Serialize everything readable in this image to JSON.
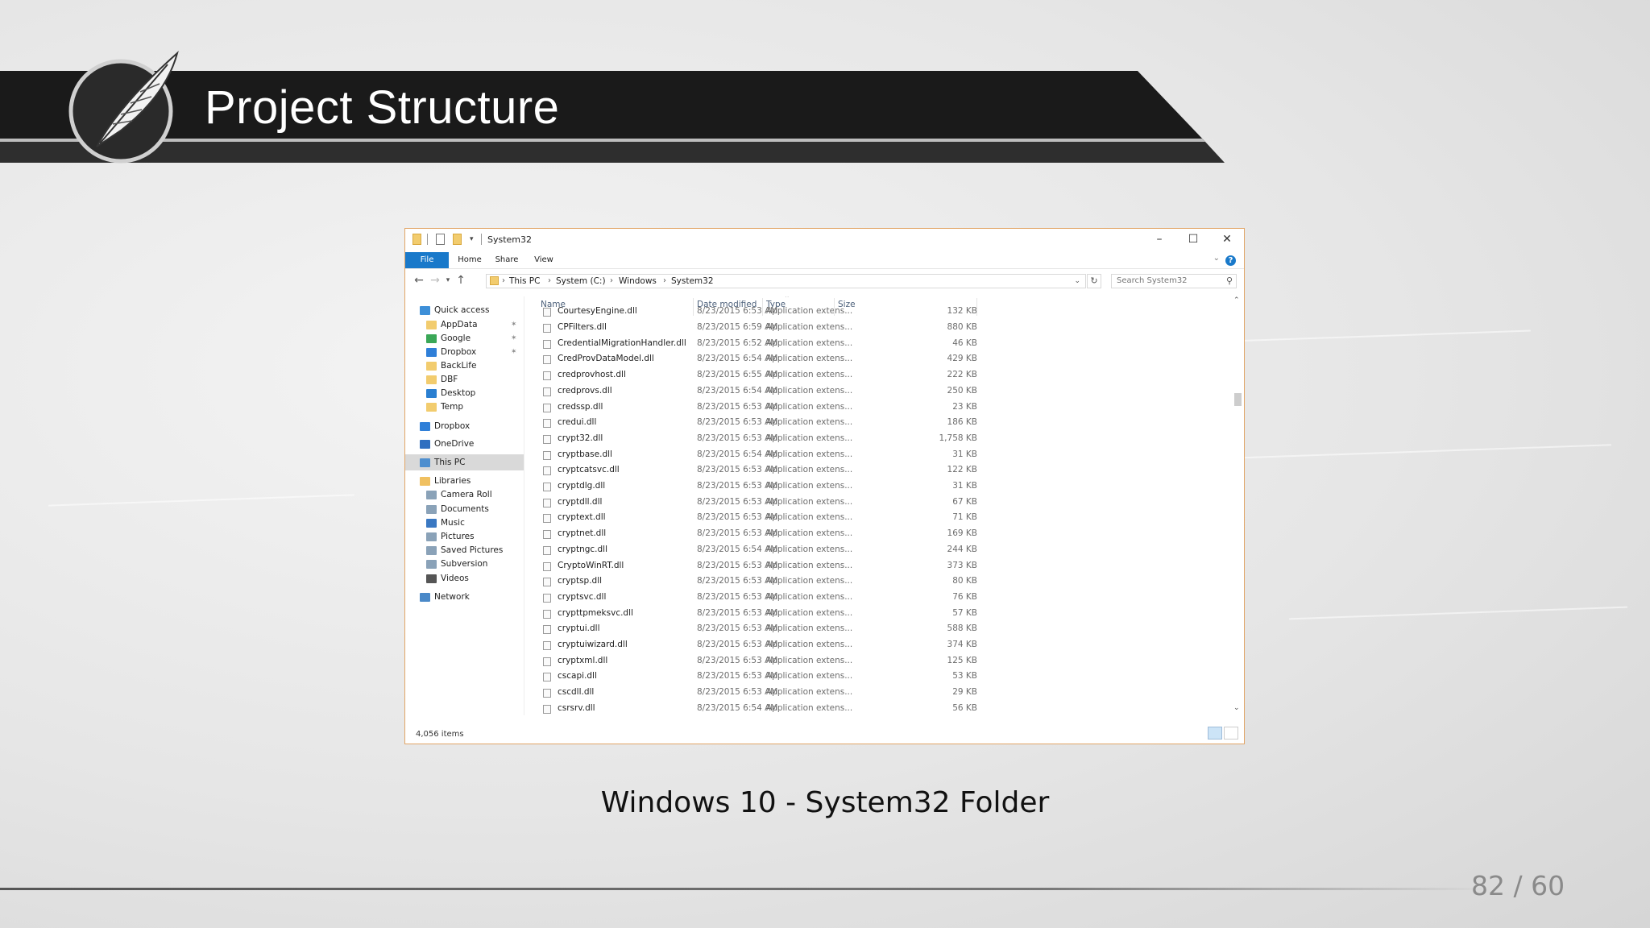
{
  "slide": {
    "title": "Project Structure",
    "caption": "Windows 10 - System32 Folder",
    "page_number": "82 / 60"
  },
  "window": {
    "title": "System32",
    "controls": {
      "minimize": "–",
      "maximize": "☐",
      "close": "✕"
    },
    "ribbon_tabs": [
      "File",
      "Home",
      "Share",
      "View"
    ],
    "help_label": "?",
    "address_parts": [
      "This PC",
      "System (C:)",
      "Windows",
      "System32"
    ],
    "search_placeholder": "Search System32",
    "status_text": "4,056 items",
    "accent_color": "#1979ca"
  },
  "nav_pane": {
    "items": [
      {
        "label": "Quick access",
        "icon": "star-icon"
      },
      {
        "label": "AppData",
        "icon": "folder-icon",
        "pinned": true
      },
      {
        "label": "Google",
        "icon": "google-drive-icon",
        "pinned": true
      },
      {
        "label": "Dropbox",
        "icon": "dropbox-icon",
        "pinned": true
      },
      {
        "label": "BackLife",
        "icon": "folder-icon"
      },
      {
        "label": "DBF",
        "icon": "folder-icon"
      },
      {
        "label": "Desktop",
        "icon": "desktop-icon"
      },
      {
        "label": "Temp",
        "icon": "folder-icon"
      },
      {
        "label": "Dropbox",
        "icon": "dropbox-icon"
      },
      {
        "label": "OneDrive",
        "icon": "cloud-icon"
      },
      {
        "label": "This PC",
        "icon": "computer-icon",
        "selected": true
      },
      {
        "label": "Libraries",
        "icon": "library-icon"
      },
      {
        "label": "Camera Roll",
        "icon": "library-folder-icon"
      },
      {
        "label": "Documents",
        "icon": "documents-icon"
      },
      {
        "label": "Music",
        "icon": "music-icon"
      },
      {
        "label": "Pictures",
        "icon": "pictures-icon"
      },
      {
        "label": "Saved Pictures",
        "icon": "library-folder-icon"
      },
      {
        "label": "Subversion",
        "icon": "library-folder-icon"
      },
      {
        "label": "Videos",
        "icon": "videos-icon"
      },
      {
        "label": "Network",
        "icon": "network-icon"
      }
    ]
  },
  "file_list": {
    "columns": [
      "Name",
      "Date modified",
      "Type",
      "Size"
    ],
    "partial_top_row": {
      "name": "CourtesyEngine.dll",
      "date": "8/23/2015 6:53 AM",
      "type": "Application extens...",
      "size": "132 KB"
    },
    "rows": [
      {
        "name": "CPFilters.dll",
        "date": "8/23/2015 6:59 AM",
        "type": "Application extens...",
        "size": "880 KB"
      },
      {
        "name": "CredentialMigrationHandler.dll",
        "date": "8/23/2015 6:52 AM",
        "type": "Application extens...",
        "size": "46 KB"
      },
      {
        "name": "CredProvDataModel.dll",
        "date": "8/23/2015 6:54 AM",
        "type": "Application extens...",
        "size": "429 KB"
      },
      {
        "name": "credprovhost.dll",
        "date": "8/23/2015 6:55 AM",
        "type": "Application extens...",
        "size": "222 KB"
      },
      {
        "name": "credprovs.dll",
        "date": "8/23/2015 6:54 AM",
        "type": "Application extens...",
        "size": "250 KB"
      },
      {
        "name": "credssp.dll",
        "date": "8/23/2015 6:53 AM",
        "type": "Application extens...",
        "size": "23 KB"
      },
      {
        "name": "credui.dll",
        "date": "8/23/2015 6:53 AM",
        "type": "Application extens...",
        "size": "186 KB"
      },
      {
        "name": "crypt32.dll",
        "date": "8/23/2015 6:53 AM",
        "type": "Application extens...",
        "size": "1,758 KB"
      },
      {
        "name": "cryptbase.dll",
        "date": "8/23/2015 6:54 AM",
        "type": "Application extens...",
        "size": "31 KB"
      },
      {
        "name": "cryptcatsvc.dll",
        "date": "8/23/2015 6:53 AM",
        "type": "Application extens...",
        "size": "122 KB"
      },
      {
        "name": "cryptdlg.dll",
        "date": "8/23/2015 6:53 AM",
        "type": "Application extens...",
        "size": "31 KB"
      },
      {
        "name": "cryptdll.dll",
        "date": "8/23/2015 6:53 AM",
        "type": "Application extens...",
        "size": "67 KB"
      },
      {
        "name": "cryptext.dll",
        "date": "8/23/2015 6:53 AM",
        "type": "Application extens...",
        "size": "71 KB"
      },
      {
        "name": "cryptnet.dll",
        "date": "8/23/2015 6:53 AM",
        "type": "Application extens...",
        "size": "169 KB"
      },
      {
        "name": "cryptngc.dll",
        "date": "8/23/2015 6:54 AM",
        "type": "Application extens...",
        "size": "244 KB"
      },
      {
        "name": "CryptoWinRT.dll",
        "date": "8/23/2015 6:53 AM",
        "type": "Application extens...",
        "size": "373 KB"
      },
      {
        "name": "cryptsp.dll",
        "date": "8/23/2015 6:53 AM",
        "type": "Application extens...",
        "size": "80 KB"
      },
      {
        "name": "cryptsvc.dll",
        "date": "8/23/2015 6:53 AM",
        "type": "Application extens...",
        "size": "76 KB"
      },
      {
        "name": "crypttpmeksvc.dll",
        "date": "8/23/2015 6:53 AM",
        "type": "Application extens...",
        "size": "57 KB"
      },
      {
        "name": "cryptui.dll",
        "date": "8/23/2015 6:53 AM",
        "type": "Application extens...",
        "size": "588 KB"
      },
      {
        "name": "cryptuiwizard.dll",
        "date": "8/23/2015 6:53 AM",
        "type": "Application extens...",
        "size": "374 KB"
      },
      {
        "name": "cryptxml.dll",
        "date": "8/23/2015 6:53 AM",
        "type": "Application extens...",
        "size": "125 KB"
      },
      {
        "name": "cscapi.dll",
        "date": "8/23/2015 6:53 AM",
        "type": "Application extens...",
        "size": "53 KB"
      },
      {
        "name": "cscdll.dll",
        "date": "8/23/2015 6:53 AM",
        "type": "Application extens...",
        "size": "29 KB"
      },
      {
        "name": "csrsrv.dll",
        "date": "8/23/2015 6:54 AM",
        "type": "Application extens...",
        "size": "56 KB"
      }
    ]
  }
}
